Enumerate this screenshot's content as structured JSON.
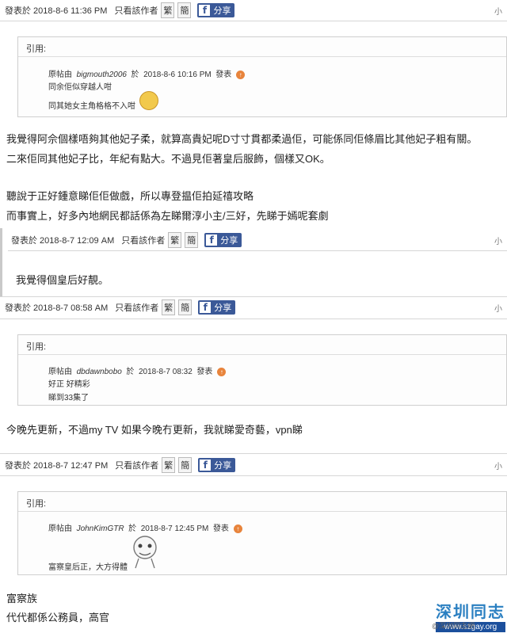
{
  "posts": [
    {
      "meta": {
        "posted": "發表於 2018-8-6 11:36 PM",
        "author_only": "只看該作者",
        "trad": "繁",
        "simp": "簡",
        "share": "分享"
      },
      "small": "小",
      "quote": {
        "label": "引用:",
        "by": "原帖由",
        "user": "bigmouth2006",
        "at": "於",
        "time": "2018-8-6 10:16 PM",
        "post_word": "發表",
        "lines": [
          "同余佢似穿越人咁",
          "同其她女主角格格不入咁"
        ]
      },
      "body": [
        "我覺得阿佘個樣唔夠其他妃子柔，就算高貴妃呢D寸寸貫都柔過佢，可能係同佢條眉比其他妃子粗有關。",
        "二來佢同其他妃子比，年紀有點大。不過見佢著皇后服飾，個樣又OK。",
        "",
        "聽說于正好鍾意睇佢佢做戲，所以專登揾佢拍延禧攻略",
        "而事實上，好多內地網民都話係為左睇爾淳小主/三好，先睇于嫣呢套劇"
      ]
    },
    {
      "meta": {
        "posted": "發表於 2018-8-7 12:09 AM",
        "author_only": "只看該作者",
        "trad": "繁",
        "simp": "簡",
        "share": "分享"
      },
      "small": "小",
      "body": [
        "我覺得個皇后好靚。"
      ]
    },
    {
      "meta": {
        "posted": "發表於 2018-8-7 08:58 AM",
        "author_only": "只看該作者",
        "trad": "繁",
        "simp": "簡",
        "share": "分享"
      },
      "small": "小",
      "quote": {
        "label": "引用:",
        "by": "原帖由",
        "user": "dbdawnbobo",
        "at": "於",
        "time": "2018-8-7 08:32",
        "post_word": "發表",
        "lines": [
          "好正  好精彩",
          "睇到33集了"
        ]
      },
      "body": [
        "今晚先更新，不過my TV 如果今晚冇更新，我就睇愛奇藝，vpn睇"
      ]
    },
    {
      "meta": {
        "posted": "發表於 2018-8-7 12:47 PM",
        "author_only": "只看該作者",
        "trad": "繁",
        "simp": "簡",
        "share": "分享"
      },
      "small": "小",
      "quote": {
        "label": "引用:",
        "by": "原帖由",
        "user": "JohnKimGTR",
        "at": "於",
        "time": "2018-8-7 12:45 PM",
        "post_word": "發表",
        "lines": [
          "富察皇后正，大方得體"
        ]
      },
      "body": [
        "富察族",
        "代代都係公務員，高官"
      ]
    }
  ],
  "watermark": {
    "brand": "深圳同志",
    "url": "www.szgay.org",
    "weibo": "@深圳同志網"
  }
}
